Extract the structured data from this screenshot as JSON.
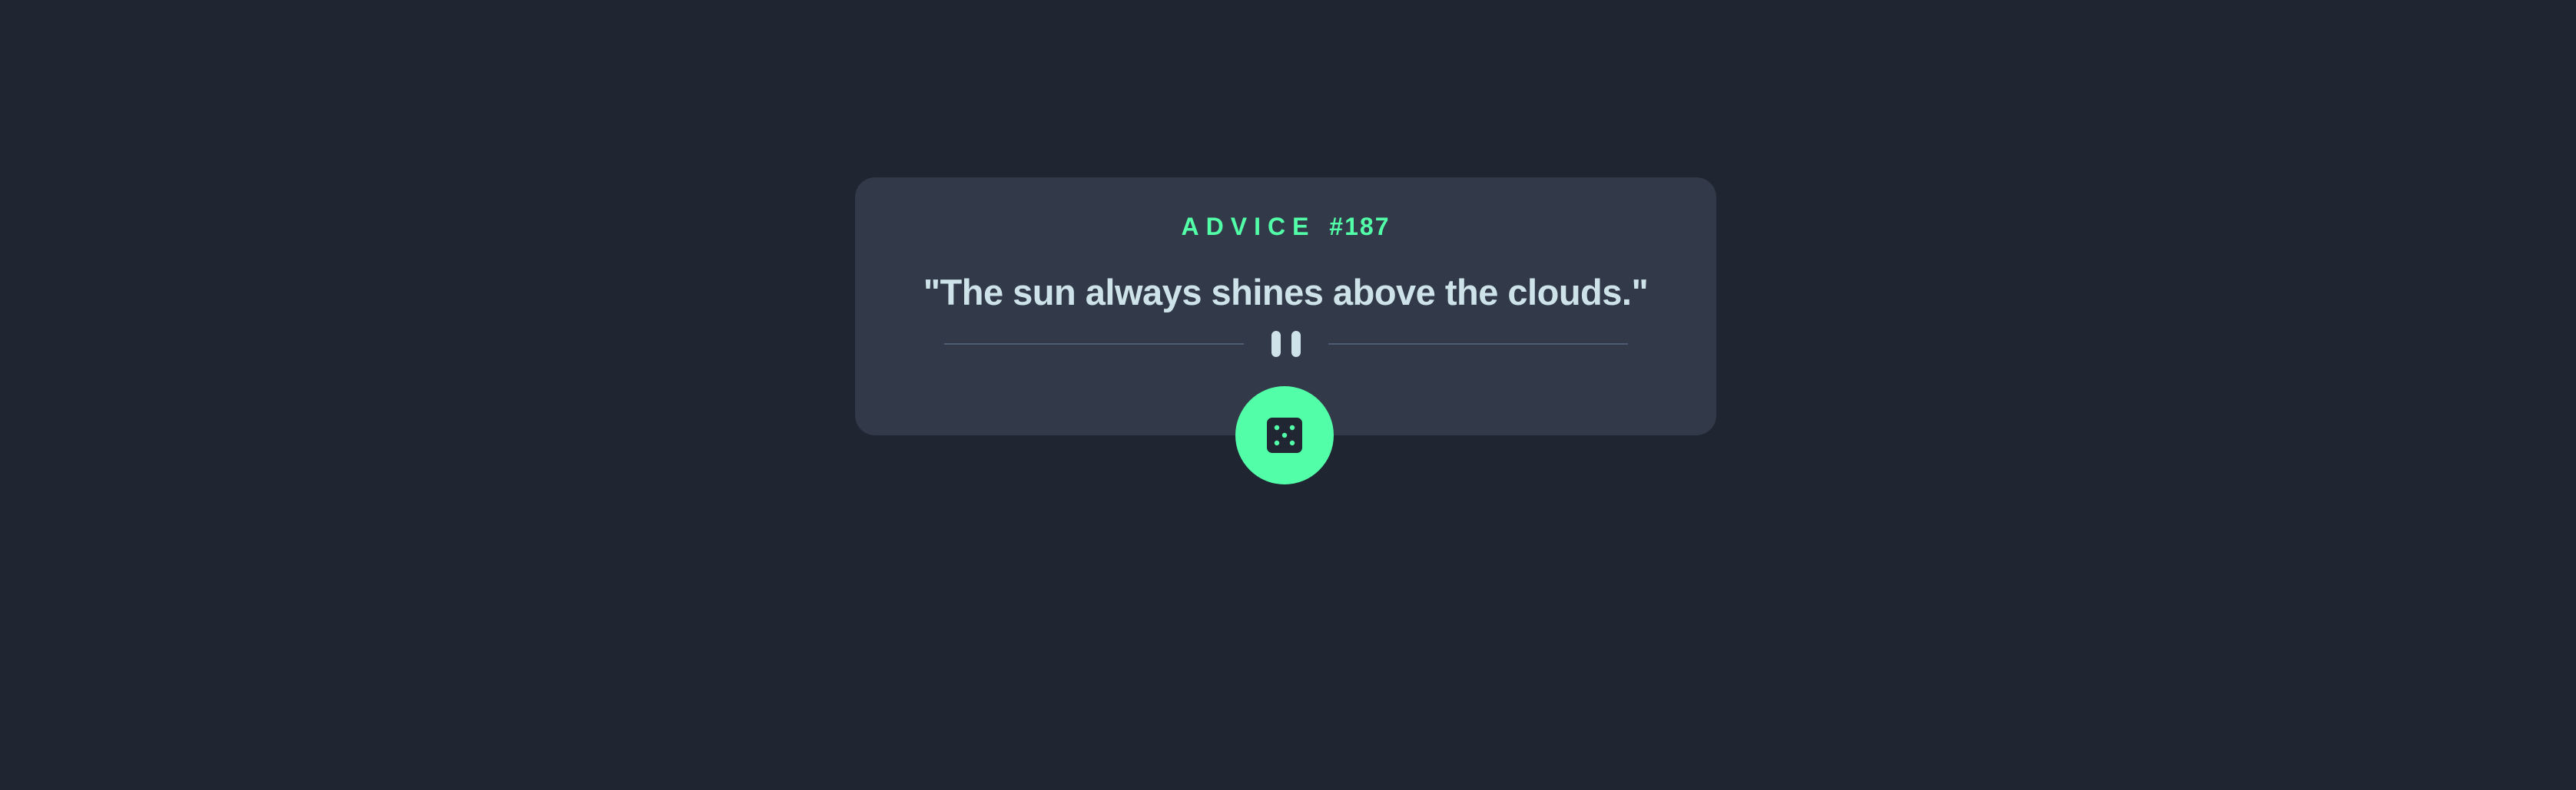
{
  "advice": {
    "label": "ADVICE",
    "number": "#187",
    "quote": "\"The sun always shines above the clouds.\""
  },
  "colors": {
    "background": "#1f2631",
    "card": "#323a49",
    "accent": "#52ffa8",
    "text": "#cee3e9",
    "divider": "#4f5d74"
  },
  "icons": {
    "divider": "pause-icon",
    "button": "dice-icon"
  }
}
